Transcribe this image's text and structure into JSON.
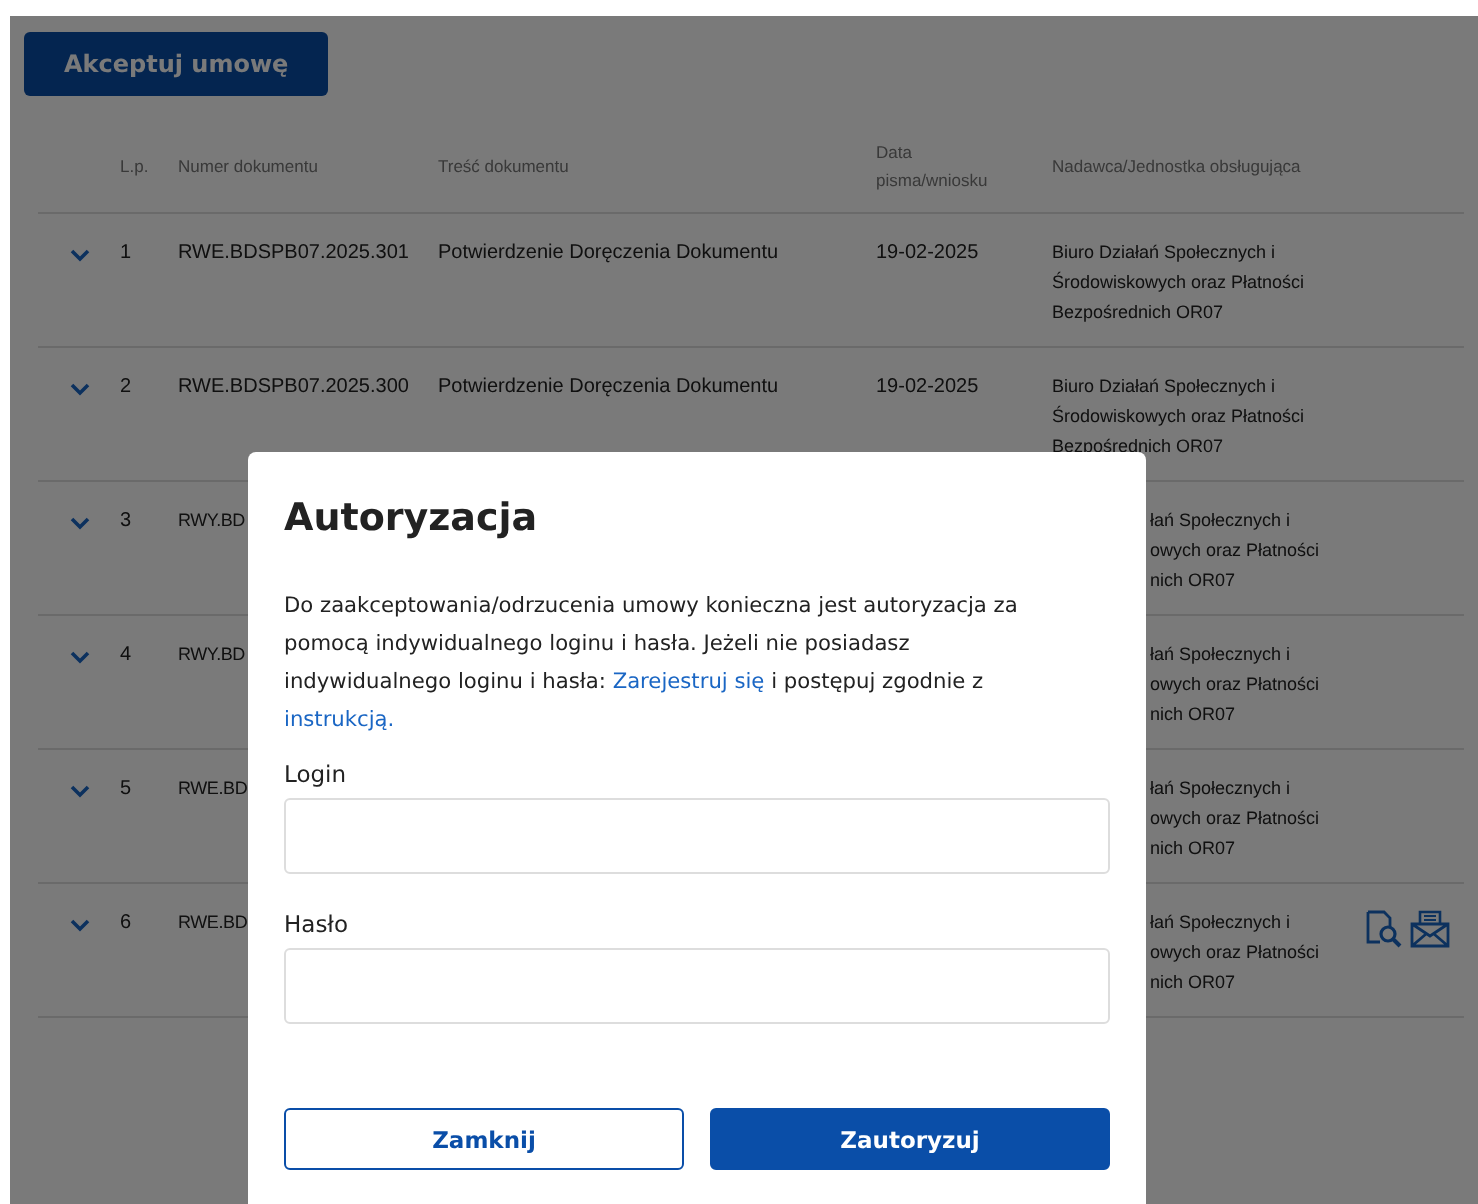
{
  "page": {
    "accept_button": "Akceptuj umowę",
    "columns": [
      "L.p.",
      "Numer dokumentu",
      "Treść dokumentu",
      "Data pisma/wniosku",
      "Nadawca/Jednostka obsługująca"
    ],
    "rows": [
      {
        "kind": "full",
        "lp": "1",
        "number": "RWE.BDSPB07.2025.301",
        "content": "Potwierdzenie Doręczenia Dokumentu",
        "date": "19-02-2025",
        "sender_lines": [
          "Biuro Działań Społecznych i",
          "Środowiskowych oraz Płatności",
          "Bezpośrednich OR07"
        ],
        "has_actions": false
      },
      {
        "kind": "full",
        "lp": "2",
        "number": "RWE.BDSPB07.2025.300",
        "content": "Potwierdzenie Doręczenia Dokumentu",
        "date": "19-02-2025",
        "sender_lines": [
          "Biuro Działań Społecznych i",
          "Środowiskowych oraz Płatności",
          "Bezpośrednich OR07"
        ],
        "has_actions": false
      },
      {
        "kind": "partial",
        "lp": "3",
        "number": "RWY.BD",
        "sender_lines": [
          "łań Społecznych i",
          "owych oraz Płatności",
          "nich OR07"
        ],
        "has_actions": false
      },
      {
        "kind": "partial",
        "lp": "4",
        "number": "RWY.BD",
        "sender_lines": [
          "łań Społecznych i",
          "owych oraz Płatności",
          "nich OR07"
        ],
        "has_actions": false
      },
      {
        "kind": "partial",
        "lp": "5",
        "number": "RWE.BD",
        "sender_lines": [
          "łań Społecznych i",
          "owych oraz Płatności",
          "nich OR07"
        ],
        "has_actions": false
      },
      {
        "kind": "partial",
        "lp": "6",
        "number": "RWE.BD",
        "sender_lines": [
          "łań Społecznych i",
          "owych oraz Płatności",
          "nich OR07"
        ],
        "has_actions": true
      }
    ]
  },
  "modal": {
    "title": "Autoryzacja",
    "message": [
      {
        "text": "Do zaakceptowania/odrzucenia umowy konieczna jest autoryzacja za pomocą indywidualnego loginu i hasła. Jeżeli nie posiadasz indywidualnego loginu i hasła: ",
        "kind": "text"
      },
      {
        "text": "Zarejestruj się",
        "kind": "link"
      },
      {
        "text": " i postępuj zgodnie z ",
        "kind": "text"
      },
      {
        "text": "instrukcją.",
        "kind": "link"
      }
    ],
    "fields": [
      {
        "label": "Login"
      },
      {
        "label": "Hasło"
      }
    ],
    "buttons": [
      {
        "label": "Zamknij",
        "kind": "secondary"
      },
      {
        "label": "Zautoryzuj",
        "kind": "primary"
      }
    ]
  }
}
